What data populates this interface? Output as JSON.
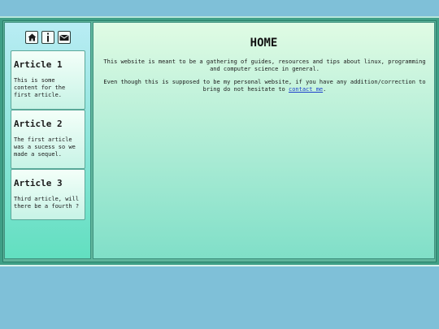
{
  "nav": {
    "icons": [
      {
        "name": "home-icon"
      },
      {
        "name": "info-icon"
      },
      {
        "name": "mail-icon"
      }
    ]
  },
  "articles": [
    {
      "title": "Article 1",
      "excerpt": "This is some content for the first article."
    },
    {
      "title": "Article 2",
      "excerpt": "The first article was a sucess so we made a sequel."
    },
    {
      "title": "Article 3",
      "excerpt": "Third article, will there be a fourth ?"
    }
  ],
  "main": {
    "heading": "HOME",
    "intro": "This website is meant to be a gathering of guides, resources and tips about linux, programming and computer science in general.",
    "contact_prefix": "Even though this is supposed to be my personal website, if you have any addition/correction to bring do not hesitate to ",
    "contact_link": "contact me",
    "contact_suffix": "."
  }
}
